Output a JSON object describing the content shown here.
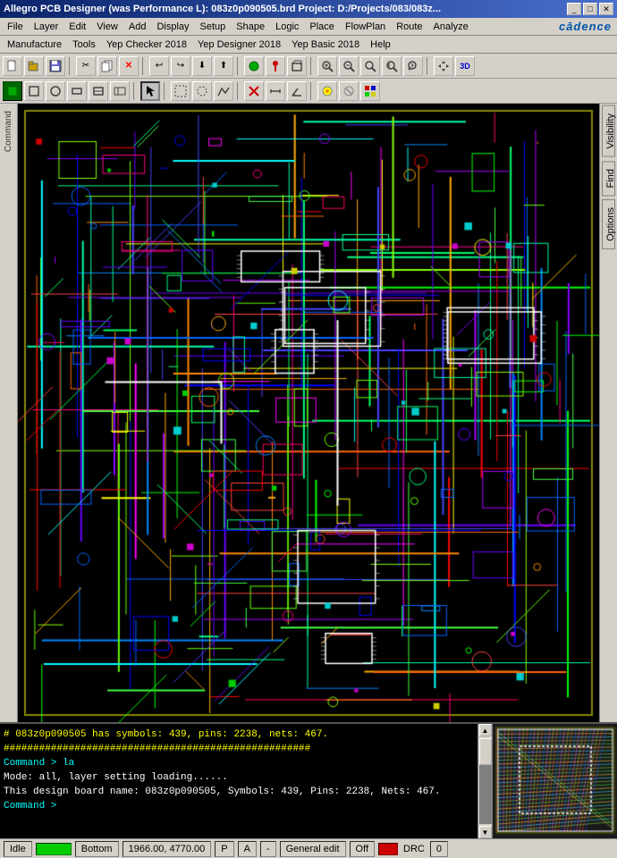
{
  "titlebar": {
    "title": "Allegro PCB Designer (was Performance L): 083z0p090505.brd  Project: D:/Projects/083/083z...",
    "controls": [
      "_",
      "□",
      "✕"
    ]
  },
  "menubar": {
    "items": [
      "File",
      "Layer",
      "Edit",
      "View",
      "Add",
      "Display",
      "Setup",
      "Shape",
      "Logic",
      "Place",
      "FlowPlan",
      "Route",
      "Analyze"
    ]
  },
  "menubar2": {
    "items": [
      "Manufacture",
      "Tools",
      "Yep Checker 2018",
      "Yep Designer 2018",
      "Yep Basic 2018",
      "Help"
    ]
  },
  "cadence_logo": "cādence",
  "toolbar1": {
    "buttons": [
      "📁",
      "📂",
      "💾",
      "✂",
      "📋",
      "❌",
      "↩",
      "↪",
      "⬇",
      "⬆",
      "🔵",
      "📌",
      "~"
    ]
  },
  "toolbar2": {
    "buttons": [
      "□",
      "□",
      "□",
      "□",
      "□",
      "□",
      "□",
      "□",
      "□",
      "□",
      "□",
      "□",
      "□",
      "□",
      "□",
      "□",
      "□"
    ]
  },
  "right_panel": {
    "tabs": [
      "Visibility",
      "Find",
      "Options"
    ]
  },
  "console": {
    "lines": [
      "# 083z0p090505 has symbols: 439, pins: 2238, nets: 467.",
      "####################################################",
      "Command > la",
      "Mode: all, layer setting loading......",
      "This design board name: 083z0p090505, Symbols: 439, Pins: 2238, Nets: 467.",
      "Command >"
    ]
  },
  "statusbar": {
    "idle": "Idle",
    "coord": "1966.00, 4770.00",
    "layer": "Bottom",
    "mode": "General edit",
    "off_label": "Off",
    "drc_label": "DRC",
    "num": "0",
    "p_marker": "P",
    "a_marker": "A"
  }
}
